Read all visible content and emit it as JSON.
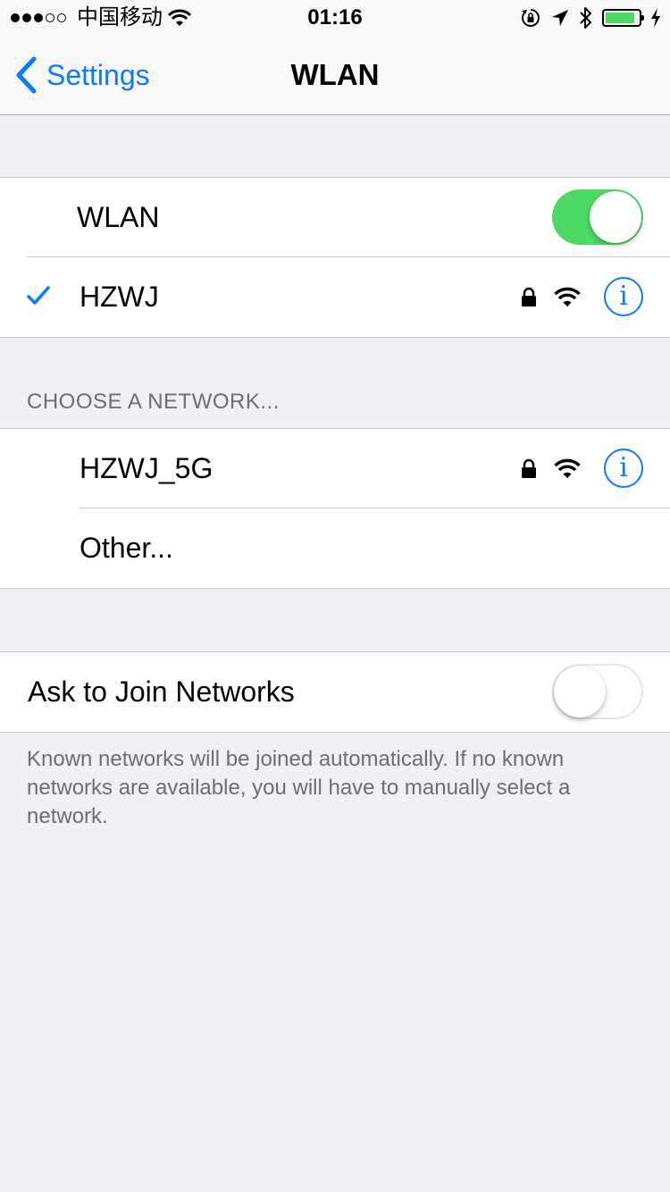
{
  "status_bar": {
    "signal_bars_full": 3,
    "signal_bars_total": 5,
    "carrier": "中国移动",
    "time": "01:16",
    "battery_level": 0.9,
    "icons": [
      "wifi-icon",
      "orientation-lock-icon",
      "location-arrow-icon",
      "bluetooth-icon",
      "battery-icon",
      "charging-bolt-icon"
    ]
  },
  "nav": {
    "back_label": "Settings",
    "title": "WLAN"
  },
  "wlan_toggle": {
    "label": "WLAN",
    "on": true
  },
  "connected_network": {
    "name": "HZWJ",
    "secured": true,
    "info_label": "i"
  },
  "choose_header": "CHOOSE A NETWORK...",
  "networks": [
    {
      "name": "HZWJ_5G",
      "secured": true,
      "info_label": "i"
    },
    {
      "name": "Other..."
    }
  ],
  "ask_to_join": {
    "label": "Ask to Join Networks",
    "on": false,
    "footer": "Known networks will be joined automatically. If no known networks are available, you will have to manually select a network."
  },
  "colors": {
    "accent": "#0a7aff",
    "toggle_on": "#4cd964",
    "background": "#efeff4",
    "secondary_text": "#6d6d72"
  }
}
